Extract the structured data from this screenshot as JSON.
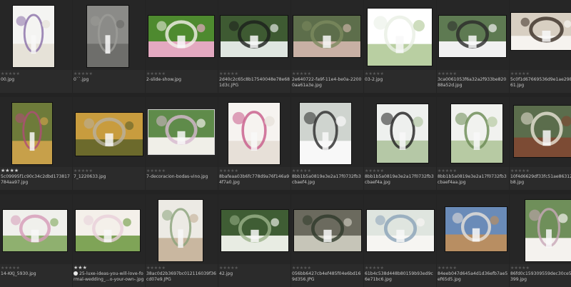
{
  "window": {
    "title": ""
  },
  "colors": {
    "background": "#232323",
    "tile": "#262626",
    "text": "#c8c8c8",
    "star_off": "#5a5a5a",
    "star_on": "#d0d0d0"
  },
  "rows": [
    [
      {
        "name": "00.jpg",
        "stars": 0
      },
      {
        "name": "0``.jpg",
        "stars": 0
      },
      {
        "name": "2-slide-show.jpg",
        "stars": 0
      },
      {
        "name": "2d40c2c65c8b17540048e78e681d3c.JPG",
        "stars": 0
      },
      {
        "name": "2e640722-fa9f-11e4-be0a-22000aa61a3e.jpg",
        "stars": 0
      },
      {
        "name": "03-2.jpg",
        "stars": 0
      },
      {
        "name": "3ca0061053f6a32a2f933be82088a52d.jpg",
        "stars": 0
      },
      {
        "name": "5c0f1d67669536d9e1ae29835961.jpg",
        "stars": 0
      }
    ],
    [
      {
        "name": "5c09995f1c90c34c2dbd173817784aa97.jpg",
        "stars": 4
      },
      {
        "name": "7_1220633.jpg",
        "stars": 0
      },
      {
        "name": "7-decoracion-bodas-vino.jpg",
        "stars": 0
      },
      {
        "name": "8bafeaa03b6fc778d9a76f146a94f7a0.jpg",
        "stars": 0
      },
      {
        "name": "8bb1b5a0819e3e2a17f0732fb3cbaef4.jpg",
        "stars": 0
      },
      {
        "name": "8bb1b5a0819e3e2a17f0732fb3cbaef4a.jpg",
        "stars": 0
      },
      {
        "name": "8bb1b5a0819e3e2a17f0732fb3cbaef4aa.jpg",
        "stars": 0
      },
      {
        "name": "10f4d6629df33fc51ae86312dd8b8.jpg",
        "stars": 0
      }
    ],
    [
      {
        "name": "14-KKJ_5930.jpg",
        "stars": 0
      },
      {
        "name": "25-luxe-ideas-you-will-love-formal-wedding_...o-your-own-.jpg",
        "stars": 3,
        "dot": true
      },
      {
        "name": "38ac0d2b3697bc012116039f36cd07e9.JPG",
        "stars": 0
      },
      {
        "name": "42.jpg",
        "stars": 0
      },
      {
        "name": "056bb6427cb4ef485f04e6bd169d356.JPG",
        "stars": 0
      },
      {
        "name": "61b4c538d448b80159b93ed9c6e71bc6.jpg",
        "stars": 0
      },
      {
        "name": "84eeb047d645a4d1d36efb7ae5ef65d5.jpg",
        "stars": 0
      },
      {
        "name": "86fd0c159309559dec30ce5fc9c399.jpg",
        "stars": 0
      }
    ]
  ]
}
